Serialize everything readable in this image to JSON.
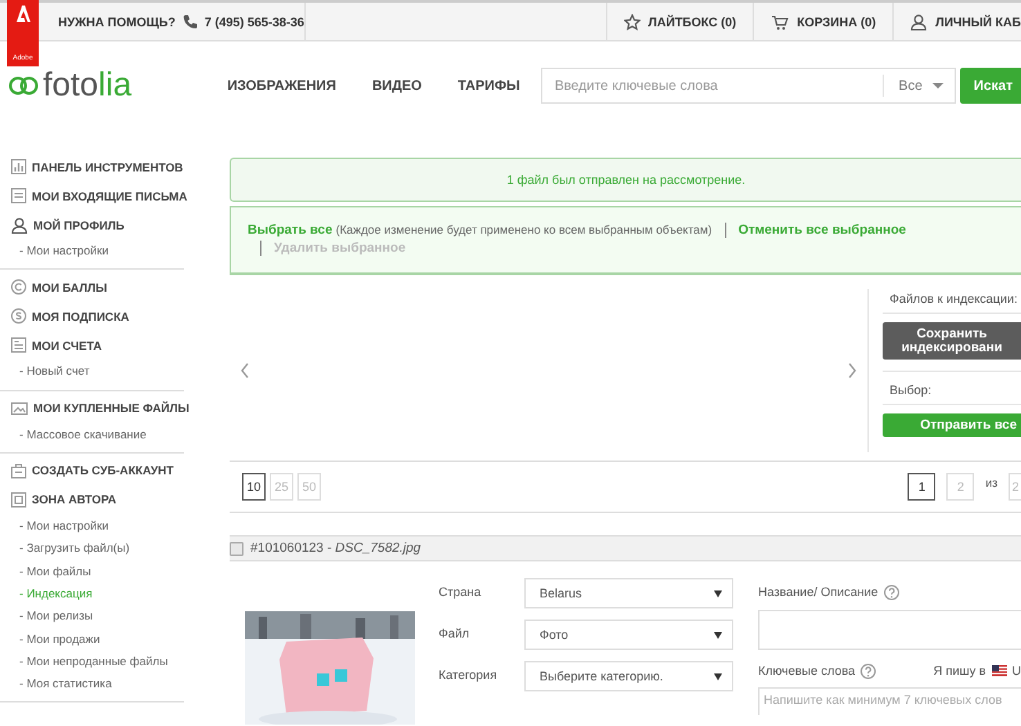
{
  "adobe_badge": "Adobe",
  "topbar": {
    "help": "НУЖНА ПОМОЩЬ?",
    "phone": "7 (495) 565-38-36",
    "links": [
      {
        "label": "ЛАЙТБОКС (0)"
      },
      {
        "label": "КОРЗИНА (0)"
      },
      {
        "label": "ЛИЧНЫЙ КАБ"
      }
    ]
  },
  "logo": {
    "text": "foto",
    "accent": "lia"
  },
  "nav": [
    "ИЗОБРАЖЕНИЯ",
    "ВИДЕО",
    "ТАРИФЫ"
  ],
  "search": {
    "placeholder": "Введите ключевые слова",
    "scope": "Все",
    "button": "Искат"
  },
  "sidebar": {
    "groups": [
      [
        {
          "label": "ПАНЕЛЬ ИНСТРУМЕНТОВ",
          "kind": "section",
          "selected": false
        },
        {
          "label": "МОИ ВХОДЯЩИЕ ПИСЬМА",
          "kind": "section",
          "selected": false
        },
        {
          "label": "МОЙ ПРОФИЛЬ",
          "kind": "section",
          "selected": false
        },
        {
          "label": "- Мои настройки",
          "kind": "sub",
          "selected": false
        }
      ],
      [
        {
          "label": "МОИ БАЛЛЫ",
          "kind": "section",
          "selected": false
        },
        {
          "label": "МОЯ ПОДПИСКА",
          "kind": "section",
          "selected": false
        },
        {
          "label": "МОИ СЧЕТА",
          "kind": "section",
          "selected": false
        },
        {
          "label": "- Новый счет",
          "kind": "sub",
          "selected": false
        }
      ],
      [
        {
          "label": "МОИ КУПЛЕННЫЕ ФАЙЛЫ",
          "kind": "section",
          "selected": false
        },
        {
          "label": "- Массовое скачивание",
          "kind": "sub",
          "selected": false
        }
      ],
      [
        {
          "label": "СОЗДАТЬ СУБ-АККАУНТ",
          "kind": "section",
          "selected": false
        },
        {
          "label": "ЗОНА АВТОРА",
          "kind": "section",
          "selected": false
        },
        {
          "label": "- Мои настройки",
          "kind": "sub",
          "selected": false
        },
        {
          "label": "- Загрузить файл(ы)",
          "kind": "sub",
          "selected": false
        },
        {
          "label": "- Мои файлы",
          "kind": "sub",
          "selected": false
        },
        {
          "label": "- Индексация",
          "kind": "sub",
          "selected": true
        },
        {
          "label": "- Мои релизы",
          "kind": "sub",
          "selected": false
        },
        {
          "label": "- Мои продажи",
          "kind": "sub",
          "selected": false
        },
        {
          "label": "- Мои непроданные файлы",
          "kind": "sub",
          "selected": false
        },
        {
          "label": "- Моя статистика",
          "kind": "sub",
          "selected": false
        }
      ]
    ]
  },
  "notice": "1 файл был отправлен на рассмотрение.",
  "selection_bar": {
    "select_all": "Выбрать все",
    "hint": "(Каждое изменение будет применено ко всем выбранным объектам)",
    "cancel_all": "Отменить все выбранное",
    "delete": {
      "label": "Удалить выбранное",
      "disabled": true
    }
  },
  "side_panel": {
    "files_label": "Файлов к индексации:",
    "save_button": "Сохранить индексировани",
    "choice_label": "Выбор:",
    "send_button": "Отправить все"
  },
  "page_sizes": [
    {
      "label": "10",
      "selected": true
    },
    {
      "label": "25",
      "selected": false
    },
    {
      "label": "50",
      "selected": false
    }
  ],
  "pagination": {
    "pages": [
      {
        "label": "1",
        "selected": true
      },
      {
        "label": "2",
        "selected": false
      }
    ],
    "of": "из",
    "total": "2"
  },
  "file": {
    "checked": false,
    "title": "#101060123 - *DSC_7582.jpg*"
  },
  "form": {
    "fields": [
      {
        "label": "Страна",
        "value": "Belarus"
      },
      {
        "label": "Файл",
        "value": "Фото"
      },
      {
        "label": "Категория",
        "value": "Выберите категорию."
      }
    ],
    "title_label": "Название/ Описание",
    "keywords_label": "Ключевые слова",
    "language_label": "Я пишу в",
    "language_code": "U",
    "keywords_placeholder": "Напишите как минимум 7 ключевых слов"
  }
}
